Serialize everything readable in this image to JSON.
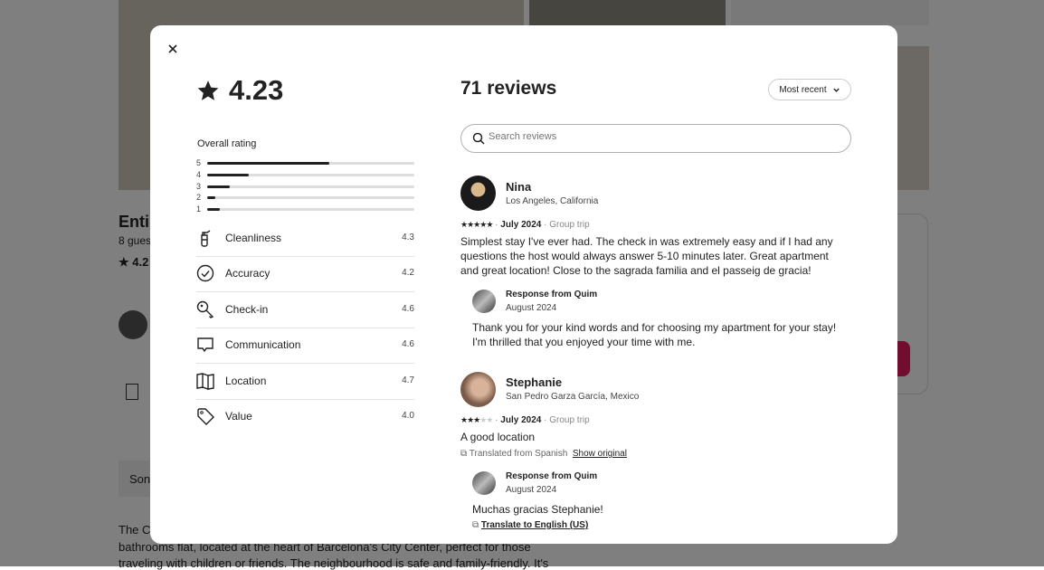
{
  "background": {
    "listing_title_partial": "Enti",
    "guests_partial": "8 gues",
    "rating_partial": "4.2",
    "chip_partial": "Son",
    "description_lines": [
      "The C",
      "bathrooms flat, located at the heart of Barcelona's City Center, perfect for those",
      "traveling with children or friends. The neighbourhood is safe and family-friendly. It's"
    ]
  },
  "modal": {
    "close_icon": "close-icon",
    "rating": "4.23",
    "overall_rating_label": "Overall rating",
    "histogram": [
      {
        "stars": "5",
        "fraction": 0.59
      },
      {
        "stars": "4",
        "fraction": 0.2
      },
      {
        "stars": "3",
        "fraction": 0.11
      },
      {
        "stars": "2",
        "fraction": 0.04
      },
      {
        "stars": "1",
        "fraction": 0.06
      }
    ],
    "categories": [
      {
        "label": "Cleanliness",
        "value": "4.3",
        "icon": "spray-bottle-icon"
      },
      {
        "label": "Accuracy",
        "value": "4.2",
        "icon": "check-circle-icon"
      },
      {
        "label": "Check-in",
        "value": "4.6",
        "icon": "key-icon"
      },
      {
        "label": "Communication",
        "value": "4.6",
        "icon": "chat-bubble-icon"
      },
      {
        "label": "Location",
        "value": "4.7",
        "icon": "map-icon"
      },
      {
        "label": "Value",
        "value": "4.0",
        "icon": "tag-icon"
      }
    ],
    "reviews_count": "71 reviews",
    "sort_label": "Most recent",
    "search_placeholder": "Search reviews",
    "reviews": [
      {
        "name": "Nina",
        "location": "Los Angeles, California",
        "stars": 5,
        "date": "July 2024",
        "trip": "Group trip",
        "text": "Simplest stay I've ever had. The check in was extremely easy and if I had any questions the host would always answer 5-10 minutes later. Great apartment and great location! Close to the sagrada familia and el passeig de gracia!",
        "response_title": "Response from Quim",
        "response_date": "August 2024",
        "response_text": "Thank you for your kind words and for choosing my apartment for your stay! I'm thrilled that you enjoyed your time with me."
      },
      {
        "name": "Stephanie",
        "location": "San Pedro Garza García, Mexico",
        "stars": 3,
        "date": "July 2024",
        "trip": "Group trip",
        "text": "A good location",
        "translated_note": "Translated from Spanish",
        "show_original": "Show original",
        "response_title": "Response from Quim",
        "response_date": "August 2024",
        "response_text": "Muchas gracias Stephanie!",
        "translate_link": "Translate to English (US)"
      }
    ]
  }
}
